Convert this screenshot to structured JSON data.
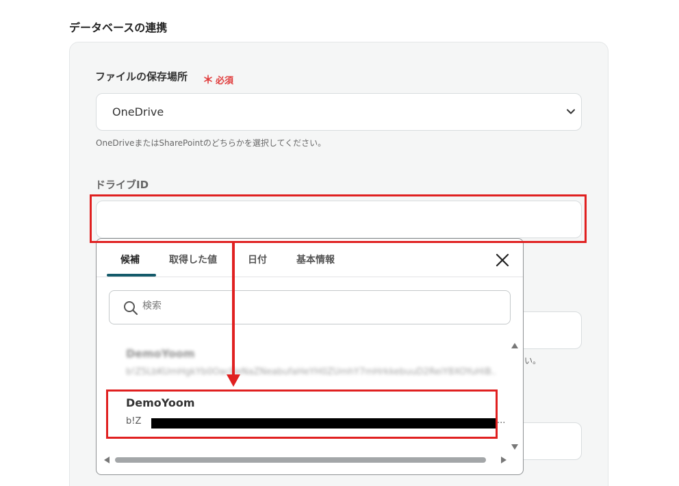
{
  "section": {
    "title": "データベースの連携"
  },
  "storage": {
    "label": "ファイルの保存場所",
    "required_mark": "＊",
    "required_text": "必須",
    "value": "OneDrive",
    "helper": "OneDriveまたはSharePointのどちらかを選択してください。"
  },
  "drive": {
    "label": "ドライブID",
    "value": ""
  },
  "background": {
    "helper_fragment": "い。"
  },
  "popup": {
    "tabs": [
      "候補",
      "取得した値",
      "日付",
      "基本情報"
    ],
    "active_tab": "候補",
    "search_placeholder": "検索",
    "items": [
      {
        "name": "DemoYoom",
        "id": "b!Z5LbKUmHgkYb0OacBeNaZNeabufaHeYH0ZUmhY7mHrkkebuuD2ReiY8XOYuHiB..."
      },
      {
        "name": "DemoYoom",
        "id": "b!Z",
        "ellipsis": "..."
      }
    ]
  },
  "colors": {
    "accent_red": "#e02020",
    "tab_underline": "#145a6a",
    "required_red": "#e03c3c"
  },
  "icons": {
    "chevron": "chevron-down-icon",
    "close": "close-icon",
    "search": "search-icon"
  }
}
